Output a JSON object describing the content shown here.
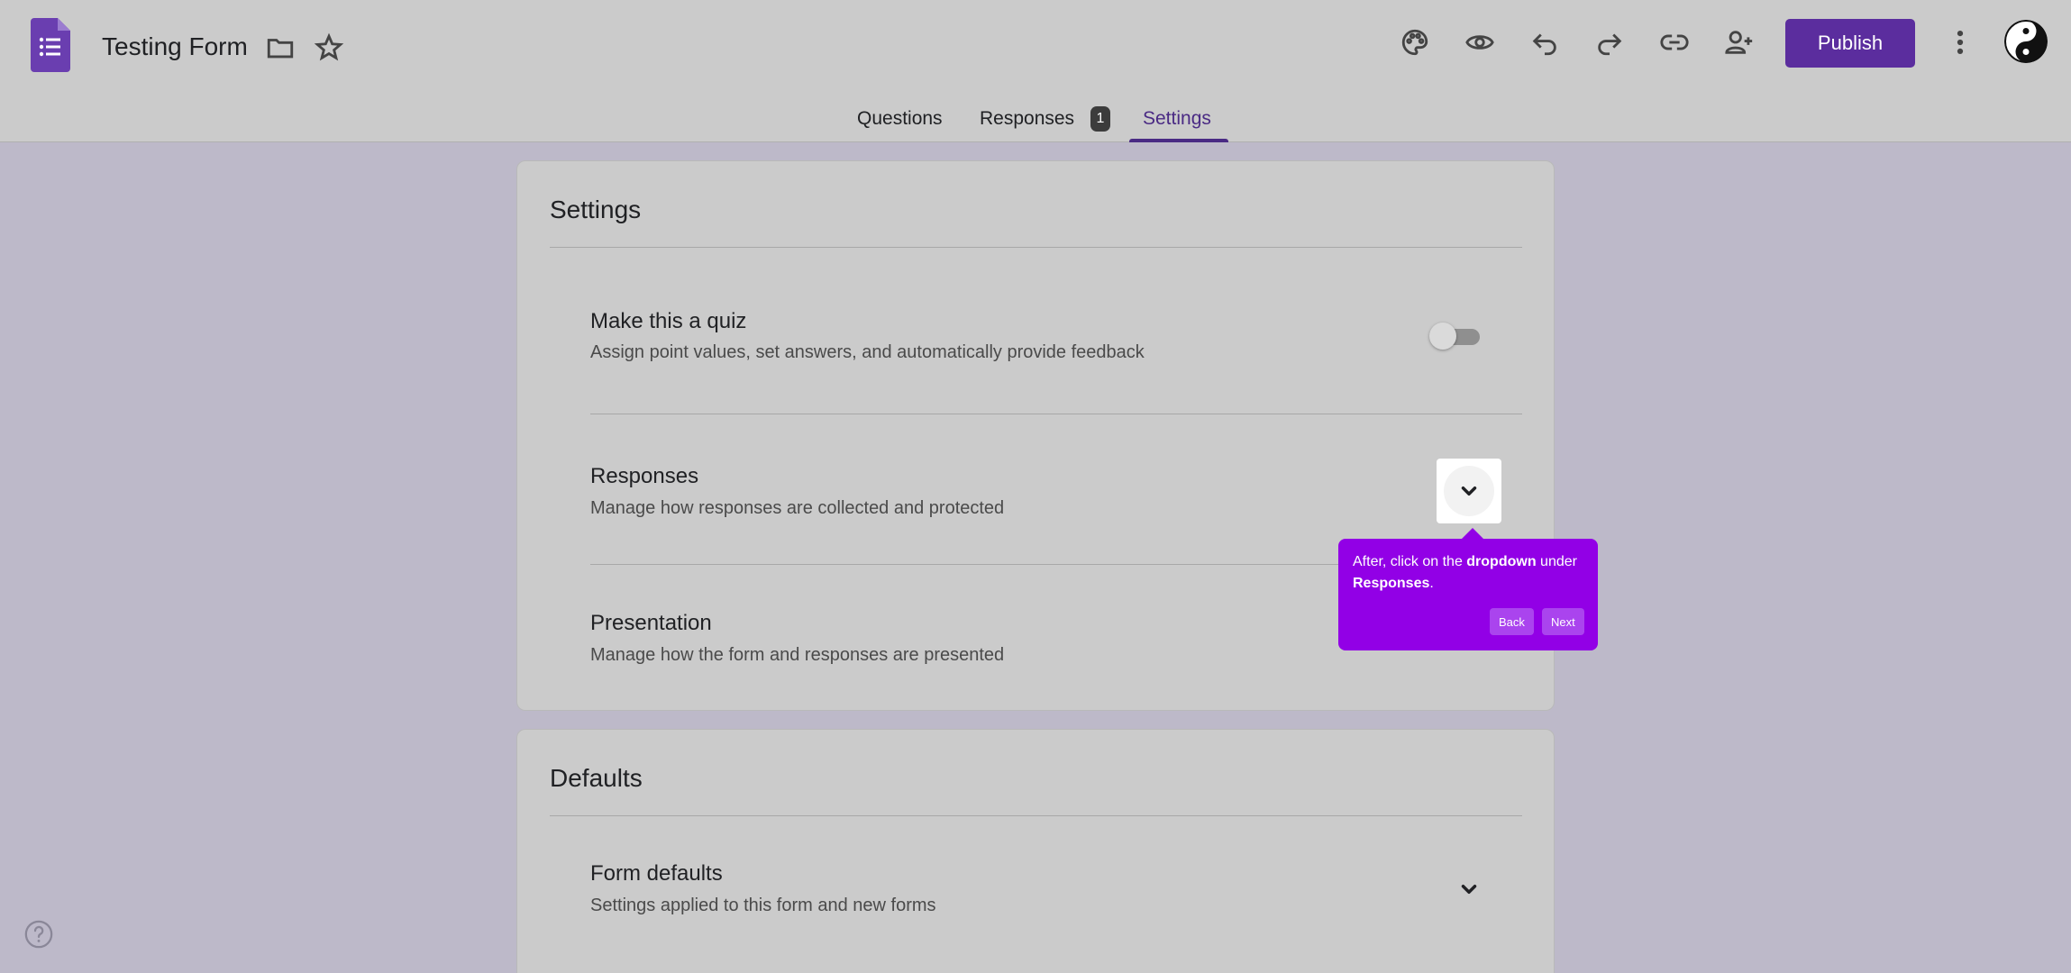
{
  "header": {
    "title": "Testing Form",
    "publish_label": "Publish",
    "icons": [
      "folder-icon",
      "star-icon",
      "palette-icon",
      "eye-icon",
      "undo-icon",
      "redo-icon",
      "link-icon",
      "add-person-icon",
      "more-vert-icon"
    ]
  },
  "tabs": [
    {
      "label": "Questions"
    },
    {
      "label": "Responses",
      "badge": "1"
    },
    {
      "label": "Settings",
      "active": true
    }
  ],
  "settings_card": {
    "title": "Settings",
    "rows": [
      {
        "title": "Make this a quiz",
        "subtitle": "Assign point values, set answers, and automatically provide feedback",
        "control": "toggle",
        "on": false
      },
      {
        "title": "Responses",
        "subtitle": "Manage how responses are collected and protected",
        "control": "dropdown"
      },
      {
        "title": "Presentation",
        "subtitle": "Manage how the form and responses are presented",
        "control": "dropdown"
      }
    ]
  },
  "defaults_card": {
    "title": "Defaults",
    "rows": [
      {
        "title": "Form defaults",
        "subtitle": "Settings applied to this form and new forms",
        "control": "dropdown"
      }
    ]
  },
  "tooltip": {
    "text_before": "After, click on the ",
    "bold1": "dropdown",
    "text_middle": " under ",
    "bold2": "Responses",
    "text_after": ".",
    "back_label": "Back",
    "next_label": "Next",
    "color": "#9200e6"
  },
  "colors": {
    "accent": "#5b2d9e",
    "active_tab": "#4a2a84"
  }
}
